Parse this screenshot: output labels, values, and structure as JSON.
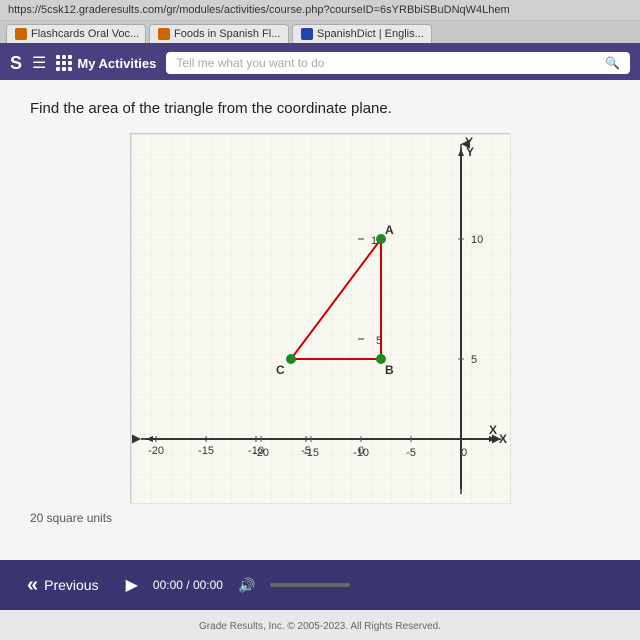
{
  "browser": {
    "url": "https://5csk12.graderesults.com/gr/modules/activities/course.php?courseID=6sYRBbiSBuDNqW4Lhem",
    "tabs": [
      {
        "label": "Flashcards Oral Voc...",
        "favicon": "orange"
      },
      {
        "label": "Foods in Spanish Fl...",
        "favicon": "orange"
      },
      {
        "label": "SpanishDict | Englis...",
        "favicon": "blue"
      }
    ]
  },
  "header": {
    "app_initial": "S",
    "my_activities_label": "My Activities",
    "search_placeholder": "Tell me what you want to do"
  },
  "question": {
    "text": "Find the area of the triangle from the coordinate plane."
  },
  "graph": {
    "x_label": "X",
    "y_label": "Y",
    "x_axis_labels": [
      "-20",
      "-15",
      "-10",
      "-5",
      "0"
    ],
    "y_axis_labels": [
      "5",
      "10"
    ],
    "points": [
      {
        "label": "A",
        "x": -8,
        "y": 10
      },
      {
        "label": "B",
        "x": -8,
        "y": 4
      },
      {
        "label": "C",
        "x": -17,
        "y": 4
      }
    ]
  },
  "answer": {
    "hint": "20 square units"
  },
  "bottom_bar": {
    "previous_label": "Previous",
    "time_current": "00:00",
    "time_total": "00:00"
  },
  "footer": {
    "text": "Grade Results, Inc. © 2005-2023. All Rights Reserved."
  }
}
